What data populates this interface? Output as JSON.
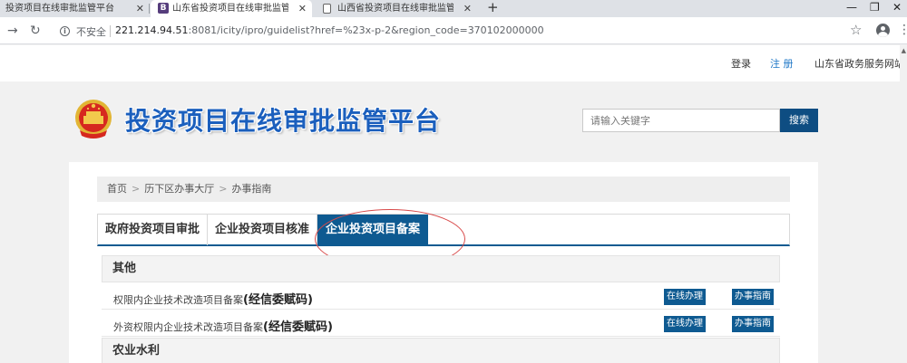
{
  "browser": {
    "tabs": [
      {
        "title": "投资项目在线审批监管平台",
        "favicon": "none"
      },
      {
        "title": "山东省投资项目在线审批监管平台",
        "favicon": "B"
      },
      {
        "title": "山西省投资项目在线审批监管平台",
        "favicon": "page-icon"
      }
    ],
    "security_label": "不安全",
    "url_host": "221.214.94.51",
    "url_path": ":8081/icity/ipro/guidelist?href=%23x-p-2&region_code=370102000000"
  },
  "topbar": {
    "login": "登录",
    "register": "注 册",
    "portal": "山东省政务服务网站"
  },
  "header": {
    "title": "投资项目在线审批监管平台",
    "search_placeholder": "请输入关键字",
    "search_button": "搜索"
  },
  "breadcrumb": [
    "首页",
    "历下区办事大厅",
    "办事指南"
  ],
  "breadcrumb_sep": ">",
  "tabs": [
    "政府投资项目审批",
    "企业投资项目核准",
    "企业投资项目备案"
  ],
  "active_tab": "企业投资项目备案",
  "sections": [
    {
      "category": "其他",
      "items": [
        {
          "name": "权限内企业技术改造项目备案",
          "tag": "(经信委赋码)",
          "btn_online": "在线办理",
          "btn_guide": "办事指南"
        },
        {
          "name": "外资权限内企业技术改造项目备案",
          "tag": "(经信委赋码)",
          "btn_online": "在线办理",
          "btn_guide": "办事指南"
        }
      ]
    },
    {
      "category": "农业水利",
      "items": []
    }
  ],
  "colors": {
    "accent": "#0e5a91",
    "title_blue": "#1b5fbd",
    "annotation_red": "#d84a4a"
  }
}
